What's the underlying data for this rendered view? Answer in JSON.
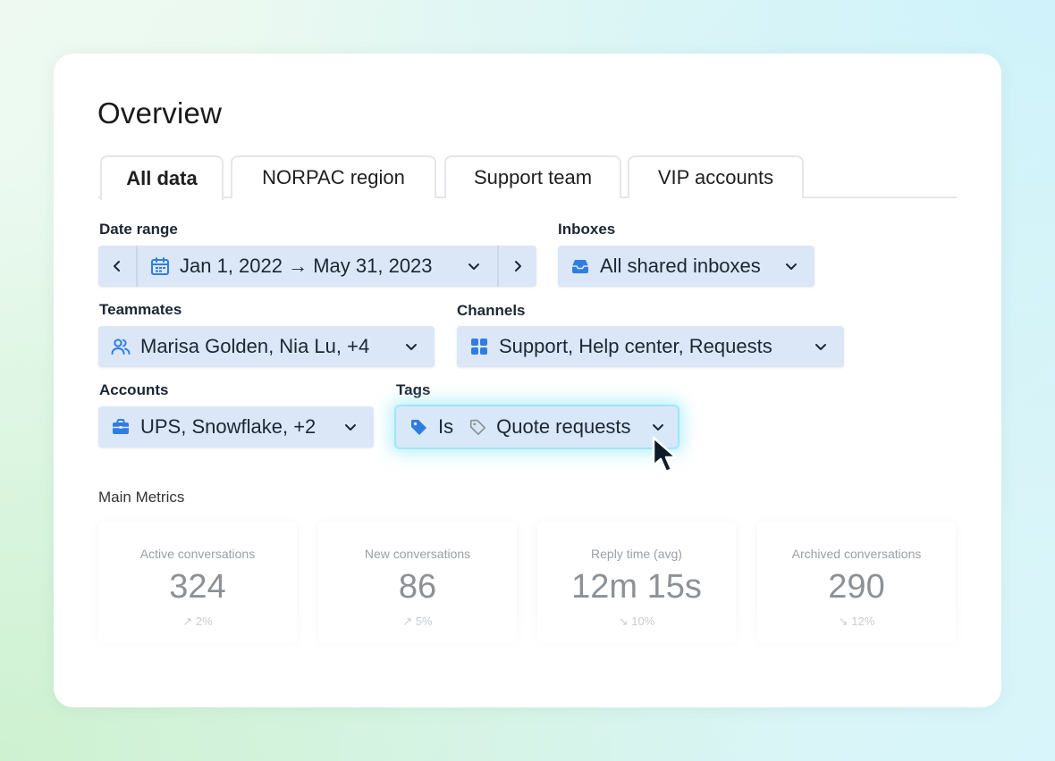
{
  "page": {
    "title": "Overview"
  },
  "tabs": [
    {
      "label": "All data",
      "active": true
    },
    {
      "label": "NORPAC region",
      "active": false
    },
    {
      "label": "Support team",
      "active": false
    },
    {
      "label": "VIP accounts",
      "active": false
    }
  ],
  "filters": {
    "date_range": {
      "label": "Date range",
      "value": "Jan 1, 2022 → May 31, 2023",
      "icon": "calendar-icon"
    },
    "inboxes": {
      "label": "Inboxes",
      "value": "All shared inboxes",
      "icon": "inbox-icon"
    },
    "teammates": {
      "label": "Teammates",
      "value": "Marisa Golden, Nia Lu, +4",
      "icon": "users-icon"
    },
    "channels": {
      "label": "Channels",
      "value": "Support, Help center, Requests",
      "icon": "grid-icon"
    },
    "accounts": {
      "label": "Accounts",
      "value": "UPS, Snowflake, +2",
      "icon": "briefcase-icon"
    },
    "tags": {
      "label": "Tags",
      "operator": "Is",
      "value": "Quote requests",
      "icon": "tag-icon"
    }
  },
  "metrics": {
    "label": "Main Metrics",
    "items": [
      {
        "name": "Active conversations",
        "value": "324",
        "delta": "↗ 2%"
      },
      {
        "name": "New conversations",
        "value": "86",
        "delta": "↗ 5%"
      },
      {
        "name": "Reply time (avg)",
        "value": "12m 15s",
        "delta": "↘ 10%"
      },
      {
        "name": "Archived conversations",
        "value": "290",
        "delta": "↘ 12%"
      }
    ]
  },
  "colors": {
    "accent": "#2f7de1",
    "pill_bg": "#dbe7f7",
    "glow": "#78e1f5"
  }
}
